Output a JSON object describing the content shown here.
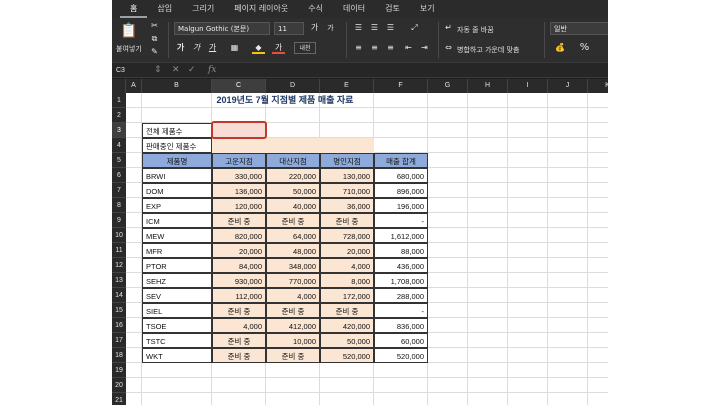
{
  "ribbon": {
    "tabs": [
      "홈",
      "삽입",
      "그리기",
      "페이지 레이아웃",
      "수식",
      "데이터",
      "검토",
      "보기"
    ],
    "paste_label": "붙여넣기",
    "font_name": "Malgun Gothic (본문)",
    "font_size": "11",
    "font_grow": "가",
    "font_shrink": "가",
    "bold": "가",
    "italic": "가",
    "underline": "가",
    "font_color_glyph": "가",
    "phonetic": "내천",
    "wrap_text": "자동 줄 바꿈",
    "merge_center": "병합하고 가운데 맞춤",
    "number_format": "일반",
    "percent": "%"
  },
  "formula_bar": {
    "name_box": "C3",
    "fx": "fx",
    "formula": ""
  },
  "columns": [
    "A",
    "B",
    "C",
    "D",
    "E",
    "F",
    "G",
    "H",
    "I",
    "J",
    "K"
  ],
  "selected_column": "C",
  "selected_row": "3",
  "rows": [
    "1",
    "2",
    "3",
    "4",
    "5",
    "6",
    "7",
    "8",
    "9",
    "10",
    "11",
    "12",
    "13",
    "14",
    "15",
    "16",
    "17",
    "18",
    "19",
    "20",
    "21"
  ],
  "sheet": {
    "title": "2019년도 7월 지점별 제품  매출 자료",
    "label_total": "전체 제품수",
    "label_selling": "판매중인 제품수",
    "headers": [
      "제품명",
      "고운지점",
      "대산지점",
      "명인지점",
      "매출 합계"
    ],
    "data": [
      [
        "BRWI",
        "330,000",
        "220,000",
        "130,000",
        "680,000"
      ],
      [
        "DOM",
        "136,000",
        "50,000",
        "710,000",
        "896,000"
      ],
      [
        "EXP",
        "120,000",
        "40,000",
        "36,000",
        "196,000"
      ],
      [
        "ICM",
        "준비 중",
        "준비 중",
        "준비 중",
        "-"
      ],
      [
        "MEW",
        "820,000",
        "64,000",
        "728,000",
        "1,612,000"
      ],
      [
        "MFR",
        "20,000",
        "48,000",
        "20,000",
        "88,000"
      ],
      [
        "PTOR",
        "84,000",
        "348,000",
        "4,000",
        "436,000"
      ],
      [
        "SEHZ",
        "930,000",
        "770,000",
        "8,000",
        "1,708,000"
      ],
      [
        "SEV",
        "112,000",
        "4,000",
        "172,000",
        "288,000"
      ],
      [
        "SIEL",
        "준비 중",
        "준비 중",
        "준비 중",
        "-"
      ],
      [
        "TSOE",
        "4,000",
        "412,000",
        "420,000",
        "836,000"
      ],
      [
        "TSTC",
        "준비 중",
        "10,000",
        "50,000",
        "60,000"
      ],
      [
        "WKT",
        "준비 중",
        "준비 중",
        "520,000",
        "520,000"
      ]
    ]
  }
}
